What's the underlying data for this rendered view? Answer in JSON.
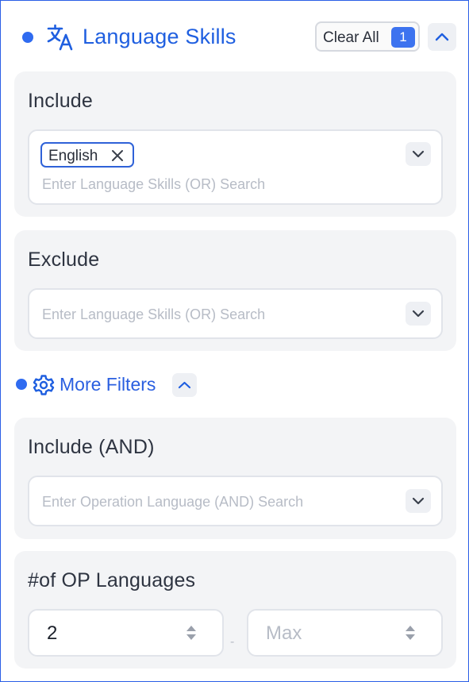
{
  "header": {
    "title": "Language Skills",
    "clear_all_label": "Clear All",
    "clear_all_count": "1",
    "accent_color": "#2f6bf0"
  },
  "include": {
    "heading": "Include",
    "chips": [
      "English"
    ],
    "placeholder": "Enter Language Skills (OR) Search"
  },
  "exclude": {
    "heading": "Exclude",
    "placeholder": "Enter Language Skills (OR) Search"
  },
  "more_filters": {
    "label": "More Filters"
  },
  "include_and": {
    "heading": "Include (AND)",
    "placeholder": "Enter Operation Language (AND) Search"
  },
  "op_languages": {
    "heading": "#of OP Languages",
    "min_value": "2",
    "max_placeholder": "Max",
    "separator": "-"
  },
  "icons": {
    "title_icon": "translate-icon",
    "more_filters_icon": "gear-icon",
    "collapse_icon": "chevron-up-icon",
    "dropdown_icon": "chevron-down-icon",
    "remove_icon": "close-icon",
    "spinner_icon": "spinner-arrows-icon"
  }
}
